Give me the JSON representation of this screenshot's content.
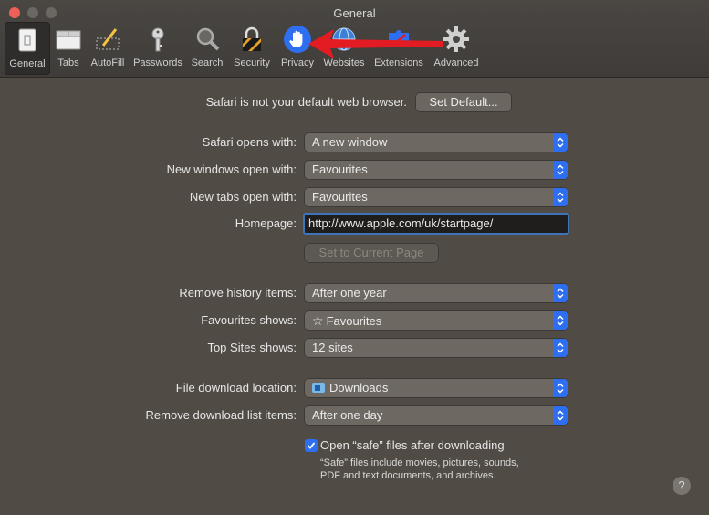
{
  "window": {
    "title": "General"
  },
  "colors": {
    "accent": "#2e6ff1",
    "arrow": "#e31b23",
    "close": "#ee5f57"
  },
  "toolbar": {
    "tabs": [
      {
        "label": "General",
        "icon": "general-icon"
      },
      {
        "label": "Tabs",
        "icon": "tabs-icon"
      },
      {
        "label": "AutoFill",
        "icon": "autofill-icon"
      },
      {
        "label": "Passwords",
        "icon": "key-icon"
      },
      {
        "label": "Search",
        "icon": "magnifier-icon"
      },
      {
        "label": "Security",
        "icon": "lock-icon"
      },
      {
        "label": "Privacy",
        "icon": "hand-icon"
      },
      {
        "label": "Websites",
        "icon": "globe-icon"
      },
      {
        "label": "Extensions",
        "icon": "puzzle-icon"
      },
      {
        "label": "Advanced",
        "icon": "gear-icon"
      }
    ]
  },
  "default_browser": {
    "message": "Safari is not your default web browser.",
    "button": "Set Default..."
  },
  "settings": {
    "opens_with": {
      "label": "Safari opens with:",
      "value": "A new window"
    },
    "new_windows": {
      "label": "New windows open with:",
      "value": "Favourites"
    },
    "new_tabs": {
      "label": "New tabs open with:",
      "value": "Favourites"
    },
    "homepage": {
      "label": "Homepage:",
      "value": "http://www.apple.com/uk/startpage/"
    },
    "set_current_page": "Set to Current Page",
    "remove_history": {
      "label": "Remove history items:",
      "value": "After one year"
    },
    "favourites_shows": {
      "label": "Favourites shows:",
      "value": "Favourites",
      "icon": "star-icon"
    },
    "top_sites": {
      "label": "Top Sites shows:",
      "value": "12 sites"
    },
    "download_location": {
      "label": "File download location:",
      "value": "Downloads",
      "icon": "downloads-folder-icon"
    },
    "remove_downloads": {
      "label": "Remove download list items:",
      "value": "After one day"
    },
    "open_safe": {
      "label": "Open “safe” files after downloading",
      "checked": true,
      "note": "“Safe” files include movies, pictures, sounds, PDF and text documents, and archives."
    }
  },
  "help": "?"
}
